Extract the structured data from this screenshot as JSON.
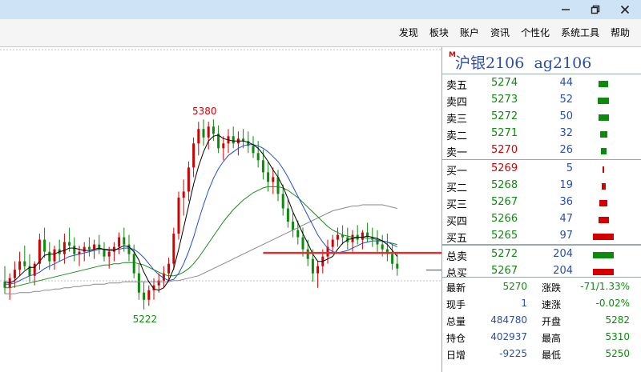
{
  "window": {
    "controls": [
      "minimize",
      "restore",
      "close"
    ]
  },
  "menu": [
    "发现",
    "板块",
    "账户",
    "资讯",
    "个性化",
    "系统工具",
    "帮助"
  ],
  "instrument": {
    "marker": "M",
    "name": "沪银2106",
    "code": "ag2106"
  },
  "asks": [
    {
      "label": "卖五",
      "price": "5274",
      "volume": "44"
    },
    {
      "label": "卖四",
      "price": "5273",
      "volume": "52"
    },
    {
      "label": "卖三",
      "price": "5272",
      "volume": "50"
    },
    {
      "label": "卖二",
      "price": "5271",
      "volume": "32"
    },
    {
      "label": "卖一",
      "price": "5270",
      "volume": "26"
    }
  ],
  "bids": [
    {
      "label": "买一",
      "price": "5269",
      "volume": "5"
    },
    {
      "label": "买二",
      "price": "5268",
      "volume": "19"
    },
    {
      "label": "买三",
      "price": "5267",
      "volume": "36"
    },
    {
      "label": "买四",
      "price": "5266",
      "volume": "47"
    },
    {
      "label": "买五",
      "price": "5265",
      "volume": "97"
    }
  ],
  "totals": [
    {
      "label": "总卖",
      "price": "5272",
      "volume": "204"
    },
    {
      "label": "总买",
      "price": "5267",
      "volume": "204"
    }
  ],
  "stats": {
    "latest": {
      "label": "最新",
      "value": "5270"
    },
    "change": {
      "label": "涨跌",
      "value": "-71/1.33%"
    },
    "lastvol": {
      "label": "现手",
      "value": "1"
    },
    "speed": {
      "label": "速涨",
      "value": "-0.02%"
    },
    "totalvol": {
      "label": "总量",
      "value": "484780"
    },
    "open": {
      "label": "开盘",
      "value": "5282"
    },
    "oi": {
      "label": "持仓",
      "value": "402937"
    },
    "high": {
      "label": "最高",
      "value": "5310"
    },
    "oichg": {
      "label": "日增",
      "value": "-9225"
    },
    "low": {
      "label": "最低",
      "value": "5250"
    }
  },
  "colors": {
    "up": "#d40000",
    "down": "#0d8a0d",
    "ma_short": "#000000",
    "ma_mid": "#1f4fd0",
    "ma_long": "#1a8a1a",
    "ma_xl": "#8a8a8a"
  },
  "chart_data": {
    "type": "candlestick",
    "annotations": [
      {
        "text": "5380",
        "kind": "high"
      },
      {
        "text": "5222",
        "kind": "low"
      }
    ],
    "current_price": 5269,
    "ylim": [
      5170,
      5440
    ],
    "candles": [
      [
        5245,
        5258,
        5235,
        5240
      ],
      [
        5240,
        5252,
        5230,
        5248
      ],
      [
        5248,
        5262,
        5240,
        5255
      ],
      [
        5255,
        5270,
        5250,
        5262
      ],
      [
        5262,
        5275,
        5255,
        5258
      ],
      [
        5258,
        5268,
        5245,
        5250
      ],
      [
        5250,
        5262,
        5242,
        5260
      ],
      [
        5260,
        5285,
        5255,
        5280
      ],
      [
        5280,
        5290,
        5265,
        5270
      ],
      [
        5270,
        5278,
        5255,
        5262
      ],
      [
        5262,
        5275,
        5255,
        5272
      ],
      [
        5272,
        5280,
        5262,
        5268
      ],
      [
        5268,
        5285,
        5260,
        5278
      ],
      [
        5278,
        5290,
        5270,
        5275
      ],
      [
        5275,
        5282,
        5262,
        5268
      ],
      [
        5268,
        5275,
        5258,
        5270
      ],
      [
        5270,
        5278,
        5262,
        5274
      ],
      [
        5274,
        5282,
        5266,
        5272
      ],
      [
        5272,
        5280,
        5264,
        5276
      ],
      [
        5276,
        5284,
        5268,
        5272
      ],
      [
        5272,
        5278,
        5262,
        5266
      ],
      [
        5266,
        5274,
        5256,
        5270
      ],
      [
        5270,
        5278,
        5262,
        5274
      ],
      [
        5274,
        5286,
        5268,
        5282
      ],
      [
        5282,
        5290,
        5270,
        5276
      ],
      [
        5276,
        5284,
        5262,
        5268
      ],
      [
        5268,
        5276,
        5248,
        5252
      ],
      [
        5252,
        5260,
        5230,
        5236
      ],
      [
        5236,
        5245,
        5222,
        5230
      ],
      [
        5230,
        5242,
        5225,
        5238
      ],
      [
        5238,
        5248,
        5230,
        5242
      ],
      [
        5242,
        5252,
        5236,
        5246
      ],
      [
        5246,
        5258,
        5240,
        5252
      ],
      [
        5252,
        5265,
        5246,
        5260
      ],
      [
        5260,
        5290,
        5255,
        5285
      ],
      [
        5285,
        5320,
        5280,
        5315
      ],
      [
        5315,
        5330,
        5300,
        5320
      ],
      [
        5320,
        5345,
        5312,
        5340
      ],
      [
        5340,
        5365,
        5332,
        5360
      ],
      [
        5360,
        5378,
        5350,
        5372
      ],
      [
        5372,
        5380,
        5358,
        5365
      ],
      [
        5365,
        5378,
        5355,
        5374
      ],
      [
        5374,
        5380,
        5362,
        5368
      ],
      [
        5368,
        5375,
        5352,
        5356
      ],
      [
        5356,
        5366,
        5346,
        5360
      ],
      [
        5360,
        5372,
        5352,
        5366
      ],
      [
        5366,
        5374,
        5356,
        5360
      ],
      [
        5360,
        5370,
        5350,
        5364
      ],
      [
        5364,
        5372,
        5356,
        5362
      ],
      [
        5362,
        5370,
        5352,
        5358
      ],
      [
        5358,
        5366,
        5348,
        5352
      ],
      [
        5352,
        5362,
        5340,
        5346
      ],
      [
        5346,
        5355,
        5330,
        5336
      ],
      [
        5336,
        5345,
        5320,
        5328
      ],
      [
        5328,
        5340,
        5318,
        5332
      ],
      [
        5332,
        5338,
        5312,
        5318
      ],
      [
        5318,
        5326,
        5300,
        5306
      ],
      [
        5306,
        5314,
        5290,
        5295
      ],
      [
        5295,
        5302,
        5282,
        5288
      ],
      [
        5288,
        5296,
        5276,
        5282
      ],
      [
        5282,
        5290,
        5266,
        5272
      ],
      [
        5272,
        5280,
        5258,
        5264
      ],
      [
        5264,
        5272,
        5245,
        5252
      ],
      [
        5252,
        5262,
        5240,
        5258
      ],
      [
        5258,
        5272,
        5252,
        5266
      ],
      [
        5266,
        5280,
        5260,
        5274
      ],
      [
        5274,
        5284,
        5268,
        5280
      ],
      [
        5280,
        5290,
        5274,
        5284
      ],
      [
        5284,
        5292,
        5276,
        5282
      ],
      [
        5282,
        5290,
        5272,
        5278
      ],
      [
        5278,
        5288,
        5270,
        5284
      ],
      [
        5284,
        5292,
        5276,
        5280
      ],
      [
        5280,
        5288,
        5272,
        5286
      ],
      [
        5286,
        5294,
        5278,
        5282
      ],
      [
        5282,
        5290,
        5274,
        5280
      ],
      [
        5280,
        5288,
        5270,
        5276
      ],
      [
        5276,
        5284,
        5266,
        5272
      ],
      [
        5272,
        5285,
        5262,
        5268
      ],
      [
        5268,
        5276,
        5255,
        5260
      ],
      [
        5260,
        5270,
        5250,
        5256
      ]
    ],
    "moving_averages": {
      "ma_short": [
        5245,
        5244,
        5246,
        5250,
        5254,
        5257,
        5257,
        5262,
        5267,
        5268,
        5268,
        5270,
        5271,
        5273,
        5273,
        5272,
        5271,
        5271,
        5272,
        5273,
        5272,
        5271,
        5271,
        5273,
        5275,
        5274,
        5270,
        5263,
        5253,
        5245,
        5239,
        5238,
        5240,
        5246,
        5256,
        5272,
        5290,
        5308,
        5326,
        5341,
        5353,
        5362,
        5366,
        5367,
        5364,
        5363,
        5362,
        5362,
        5362,
        5361,
        5359,
        5356,
        5351,
        5345,
        5338,
        5332,
        5324,
        5314,
        5303,
        5294,
        5285,
        5277,
        5268,
        5262,
        5262,
        5264,
        5266,
        5272,
        5277,
        5280,
        5281,
        5282,
        5282,
        5283,
        5282,
        5281,
        5279,
        5276,
        5271,
        5266
      ],
      "ma_mid": [
        5243,
        5243,
        5244,
        5246,
        5248,
        5250,
        5251,
        5253,
        5256,
        5258,
        5260,
        5262,
        5264,
        5266,
        5267,
        5268,
        5269,
        5270,
        5271,
        5272,
        5272,
        5272,
        5272,
        5272,
        5273,
        5273,
        5272,
        5269,
        5265,
        5260,
        5255,
        5251,
        5248,
        5246,
        5247,
        5252,
        5260,
        5270,
        5282,
        5296,
        5309,
        5321,
        5331,
        5339,
        5345,
        5350,
        5353,
        5356,
        5358,
        5359,
        5359,
        5358,
        5356,
        5353,
        5349,
        5345,
        5339,
        5332,
        5324,
        5316,
        5308,
        5300,
        5292,
        5284,
        5278,
        5273,
        5270,
        5269,
        5270,
        5271,
        5273,
        5275,
        5277,
        5278,
        5279,
        5279,
        5279,
        5278,
        5276,
        5274
      ],
      "ma_long": [
        5240,
        5240,
        5241,
        5242,
        5243,
        5244,
        5245,
        5246,
        5247,
        5248,
        5249,
        5250,
        5251,
        5252,
        5253,
        5254,
        5255,
        5256,
        5257,
        5258,
        5259,
        5259,
        5260,
        5260,
        5261,
        5261,
        5261,
        5260,
        5259,
        5257,
        5255,
        5253,
        5251,
        5250,
        5250,
        5251,
        5253,
        5256,
        5260,
        5265,
        5271,
        5277,
        5283,
        5289,
        5295,
        5300,
        5305,
        5309,
        5313,
        5316,
        5319,
        5321,
        5323,
        5324,
        5324,
        5324,
        5323,
        5321,
        5318,
        5315,
        5311,
        5307,
        5303,
        5299,
        5295,
        5291,
        5288,
        5286,
        5284,
        5283,
        5282,
        5282,
        5282,
        5281,
        5281,
        5280,
        5279,
        5278,
        5277,
        5276
      ],
      "ma_xl": [
        5235,
        5235,
        5235,
        5236,
        5236,
        5236,
        5237,
        5237,
        5238,
        5238,
        5239,
        5239,
        5240,
        5240,
        5241,
        5241,
        5242,
        5242,
        5243,
        5243,
        5243,
        5244,
        5244,
        5244,
        5245,
        5245,
        5245,
        5245,
        5245,
        5245,
        5245,
        5245,
        5245,
        5245,
        5246,
        5246,
        5247,
        5248,
        5249,
        5250,
        5252,
        5254,
        5256,
        5258,
        5260,
        5262,
        5264,
        5266,
        5268,
        5270,
        5272,
        5274,
        5276,
        5278,
        5280,
        5282,
        5284,
        5286,
        5288,
        5290,
        5292,
        5294,
        5296,
        5298,
        5300,
        5302,
        5304,
        5305,
        5306,
        5307,
        5308,
        5308,
        5309,
        5309,
        5309,
        5309,
        5309,
        5308,
        5307,
        5306
      ]
    }
  }
}
